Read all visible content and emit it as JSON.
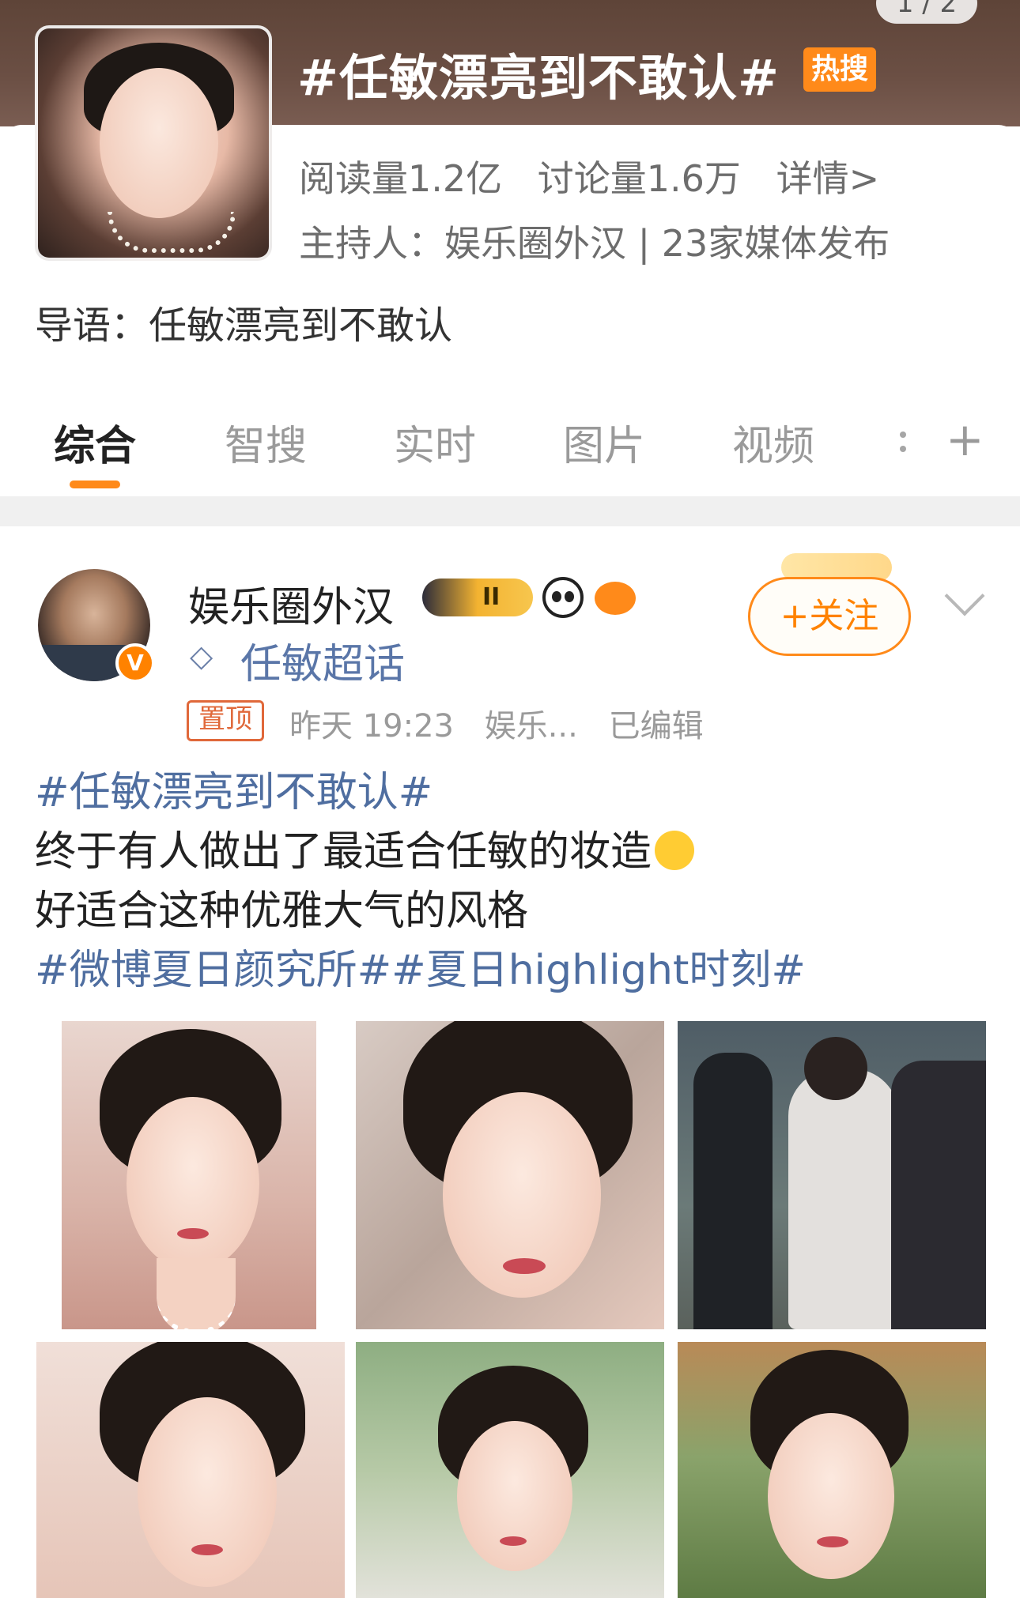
{
  "page_indicator": "1 / 2",
  "topic": {
    "title": "#任敏漂亮到不敢认#",
    "badge": "热搜",
    "reads": "阅读量1.2亿",
    "discussions": "讨论量1.6万",
    "details_link": "详情>",
    "host": "主持人：娱乐圈外汉 | 23家媒体发布",
    "intro": "导语：任敏漂亮到不敢认"
  },
  "tabs": [
    {
      "label": "综合",
      "active": true
    },
    {
      "label": "智搜"
    },
    {
      "label": "实时"
    },
    {
      "label": "图片"
    },
    {
      "label": "视频"
    }
  ],
  "tab_add": "+",
  "post": {
    "username": "娱乐圈外汉",
    "level_badge": "II",
    "super_topic": "任敏超话",
    "follow_label": "+关注",
    "pinned": "置顶",
    "time": "昨天 19:23",
    "source": "娱乐...",
    "edited": "已编辑",
    "lines": [
      "#任敏漂亮到不敢认#",
      "终于有人做出了最适合任敏的妆造",
      "好适合这种优雅大气的风格",
      "#微博夏日颜究所##夏日highlight时刻#"
    ],
    "verified_mark": "V"
  },
  "icons": {
    "verified": "verified-v-icon",
    "crown": "crown-icon",
    "panda": "panda-icon",
    "fish": "fish-icon",
    "supertopic": "diamond-icon",
    "emoji": "touched-emoji-icon",
    "more": "chevron-down-icon"
  },
  "colors": {
    "accent": "#ff8200",
    "hashtag": "#4f6ea0",
    "header_bg": "#6b4f44"
  }
}
